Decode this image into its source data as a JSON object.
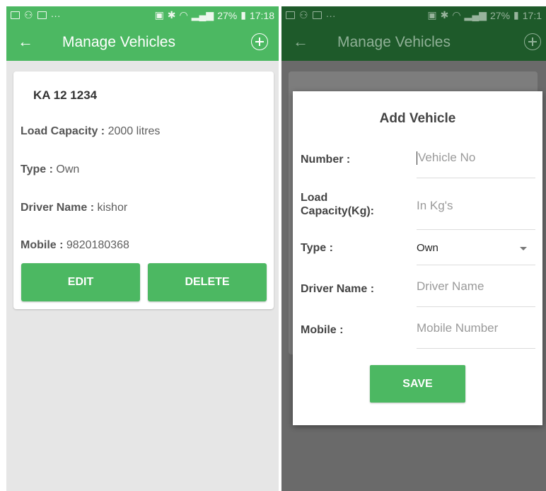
{
  "status": {
    "battery_text": "27%",
    "time_left": "17:18",
    "time_right": "17:1",
    "dots": "···"
  },
  "appbar": {
    "title": "Manage Vehicles",
    "back_glyph": "←"
  },
  "vehicle": {
    "number": "KA 12 1234",
    "load_label": "Load Capacity :",
    "load_value": "2000 litres",
    "type_label": "Type :",
    "type_value": "Own",
    "driver_label": "Driver Name :",
    "driver_value": "kishor",
    "mobile_label": "Mobile :",
    "mobile_value": "9820180368",
    "edit_label": "EDIT",
    "delete_label": "DELETE"
  },
  "dialog": {
    "title": "Add Vehicle",
    "number_label": "Number :",
    "number_placeholder": "Vehicle No",
    "load_label_1": "Load",
    "load_label_2": "Capacity(Kg):",
    "load_placeholder": "In Kg's",
    "type_label": "Type :",
    "type_value": "Own",
    "driver_label": "Driver Name :",
    "driver_placeholder": "Driver Name",
    "mobile_label": "Mobile :",
    "mobile_placeholder": "Mobile Number",
    "save_label": "SAVE"
  },
  "colors": {
    "primary": "#4cb862",
    "primary_dimmed": "#1e5a2a",
    "background": "#e6e6e6"
  },
  "icons": [
    "gallery-icon",
    "usb-icon",
    "mail-icon",
    "sim-icon",
    "bluetooth-icon",
    "wifi-icon",
    "signal-icon",
    "battery-icon",
    "back-arrow-icon",
    "add-circle-icon",
    "dropdown-caret-icon"
  ]
}
